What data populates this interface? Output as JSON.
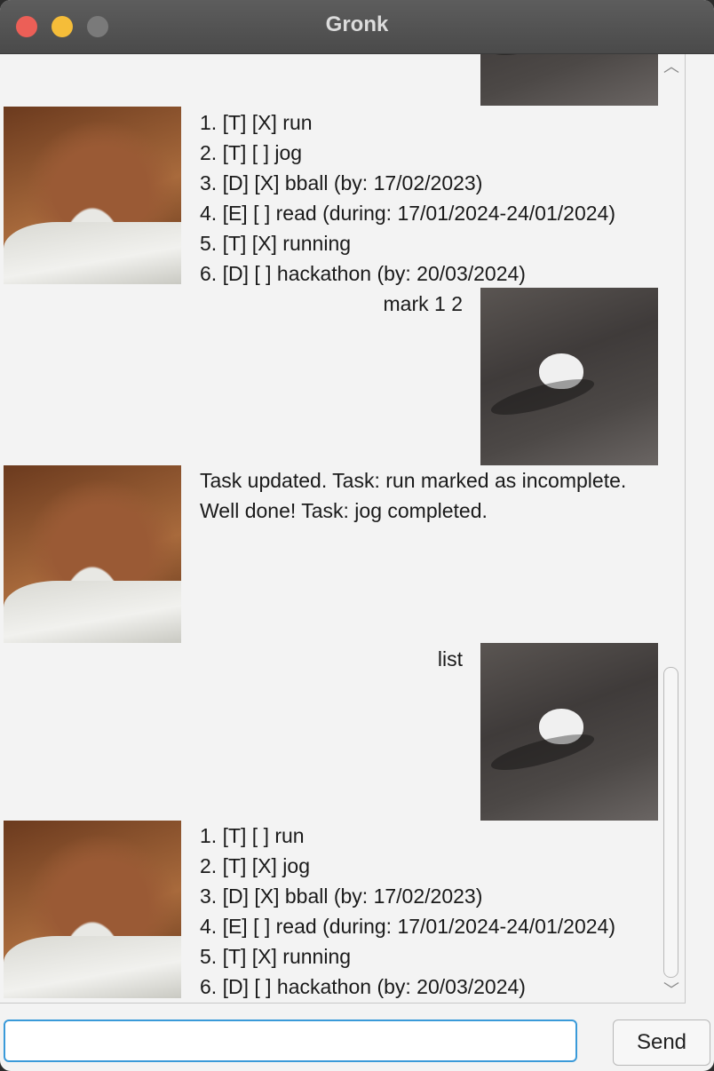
{
  "window": {
    "title": "Gronk"
  },
  "messages": [
    {
      "lines": [
        "1. [T] [X] run",
        "2. [T] [ ] jog",
        "3. [D] [X] bball (by: 17/02/2023)",
        "4. [E] [ ] read (during: 17/01/2024-24/01/2024)",
        "5. [T] [X] running",
        "6. [D] [ ] hackathon (by: 20/03/2024)"
      ]
    },
    {
      "text": "mark 1 2"
    },
    {
      "lines": [
        "Task updated. Task: run marked as incomplete.",
        "Well done! Task: jog completed."
      ]
    },
    {
      "text": "list"
    },
    {
      "lines": [
        "1. [T] [ ] run",
        "2. [T] [X] jog",
        "3. [D] [X] bball (by: 17/02/2023)",
        "4. [E] [ ] read (during: 17/01/2024-24/01/2024)",
        "5. [T] [X] running",
        "6. [D] [ ] hackathon (by: 20/03/2024)"
      ]
    }
  ],
  "input": {
    "value": ""
  },
  "send": {
    "label": "Send"
  },
  "icons": {
    "scroll_up": "chevron-up-icon",
    "scroll_down": "chevron-down-icon"
  }
}
